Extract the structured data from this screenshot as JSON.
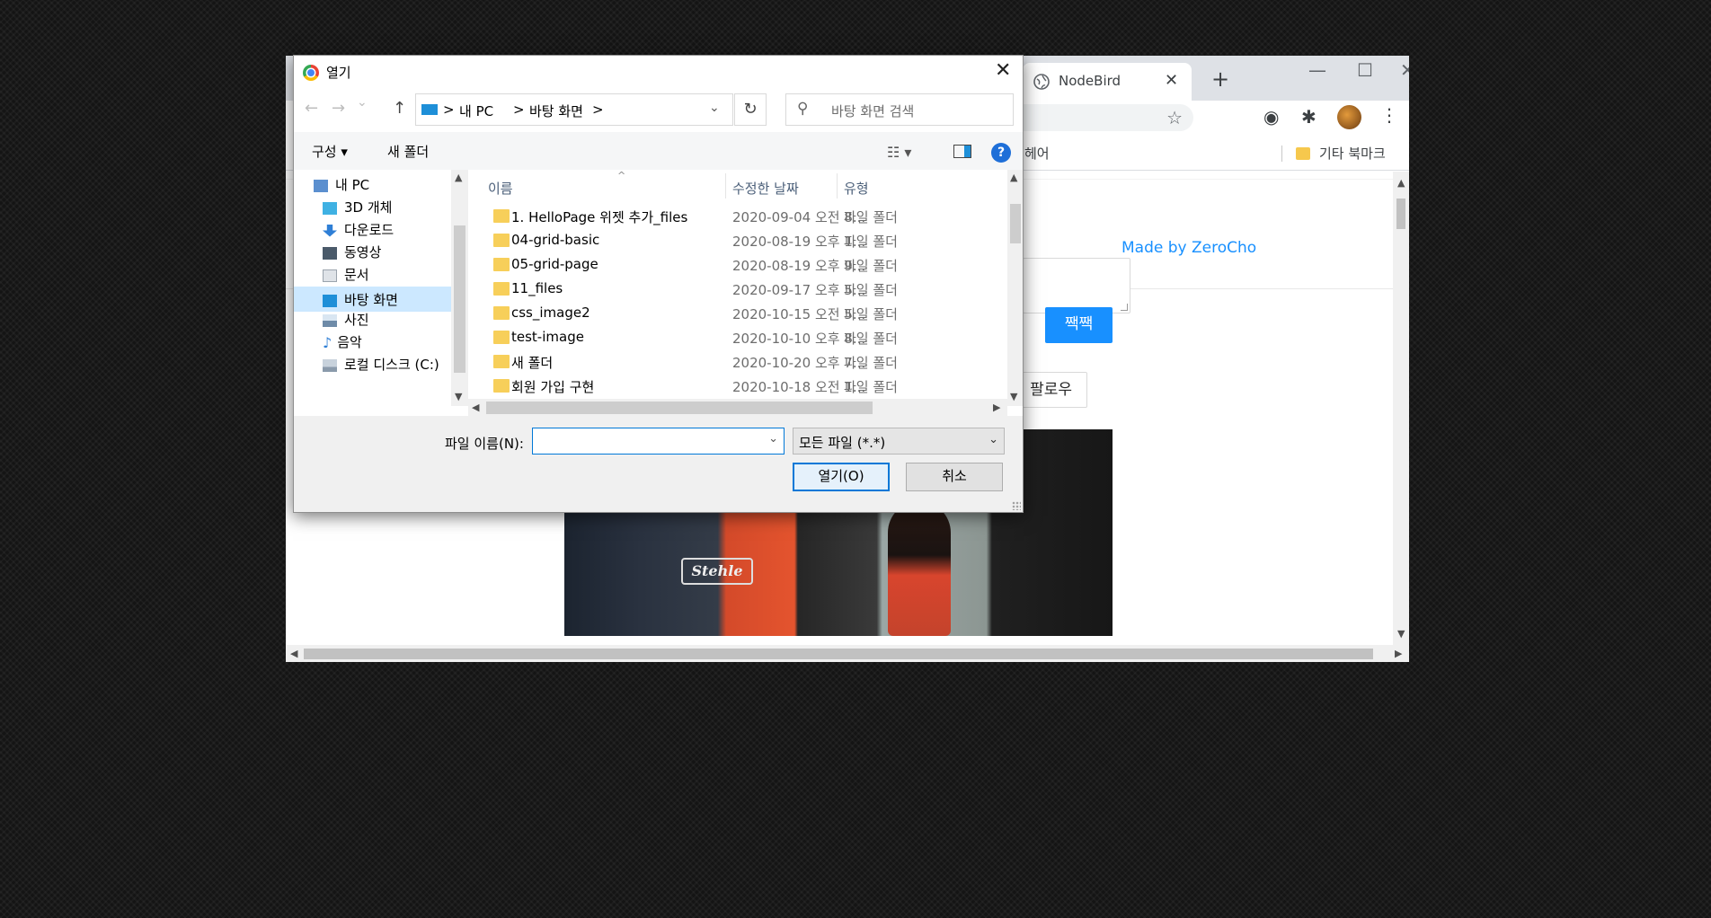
{
  "browser": {
    "tab_title": "NodeBird",
    "tab_close": "✕",
    "new_tab": "+",
    "window_controls": [
      "—",
      "☐",
      "✕"
    ],
    "bookmarks_partial": "헤어",
    "bookmarks_other": "기타 북마크",
    "page": {
      "made_by": "Made by ZeroCho",
      "tweet_button": "짹짹",
      "follow_button": "팔로우",
      "photo_sign": "Stehle"
    }
  },
  "dialog": {
    "title": "열기",
    "close": "✕",
    "nav": {
      "back": "←",
      "forward": "→",
      "recent": "⌄",
      "up": "↑"
    },
    "path": [
      "내 PC",
      "바탕 화면"
    ],
    "path_sep": ">",
    "refresh": "↻",
    "search_placeholder": "바탕 화면 검색",
    "organize": "구성 ▾",
    "new_folder": "새 폴더",
    "help": "?",
    "tree": [
      {
        "label": "내 PC",
        "icon": "pc-icon",
        "color": "#5b8fcf"
      },
      {
        "label": "3D 개체",
        "icon": "3d-objects-icon",
        "color": "#3fb1e3"
      },
      {
        "label": "다운로드",
        "icon": "downloads-icon",
        "color": "#2f7fd6"
      },
      {
        "label": "동영상",
        "icon": "videos-icon",
        "color": "#4a5a6a"
      },
      {
        "label": "문서",
        "icon": "documents-icon",
        "color": "#9aa3ad"
      },
      {
        "label": "바탕 화면",
        "icon": "desktop-icon",
        "color": "#1e8fd8"
      },
      {
        "label": "사진",
        "icon": "pictures-icon",
        "color": "#6e8ba8"
      },
      {
        "label": "음악",
        "icon": "music-icon",
        "color": "#2f7fd6"
      },
      {
        "label": "로컬 디스크 (C:)",
        "icon": "disk-icon",
        "color": "#8a9aab"
      }
    ],
    "tree_selected": "바탕 화면",
    "columns": {
      "name": "이름",
      "date": "수정한 날짜",
      "type": "유형"
    },
    "files": [
      {
        "name": "1. HelloPage 위젯 추가_files",
        "date": "2020-09-04 오전 8...",
        "type": "파일 폴더"
      },
      {
        "name": "04-grid-basic",
        "date": "2020-08-19 오후 1...",
        "type": "파일 폴더"
      },
      {
        "name": "05-grid-page",
        "date": "2020-08-19 오후 9...",
        "type": "파일 폴더"
      },
      {
        "name": "11_files",
        "date": "2020-09-17 오후 5...",
        "type": "파일 폴더"
      },
      {
        "name": "css_image2",
        "date": "2020-10-15 오전 5...",
        "type": "파일 폴더"
      },
      {
        "name": "test-image",
        "date": "2020-10-10 오후 8...",
        "type": "파일 폴더"
      },
      {
        "name": "새 폴더",
        "date": "2020-10-20 오후 7...",
        "type": "파일 폴더"
      },
      {
        "name": "회원 가입 구현",
        "date": "2020-10-18 오전 1...",
        "type": "파일 폴더"
      }
    ],
    "filename_label": "파일 이름(N):",
    "filename_value": "",
    "filetype": "모든 파일 (*.*)",
    "open_button": "열기(O)",
    "cancel_button": "취소"
  }
}
